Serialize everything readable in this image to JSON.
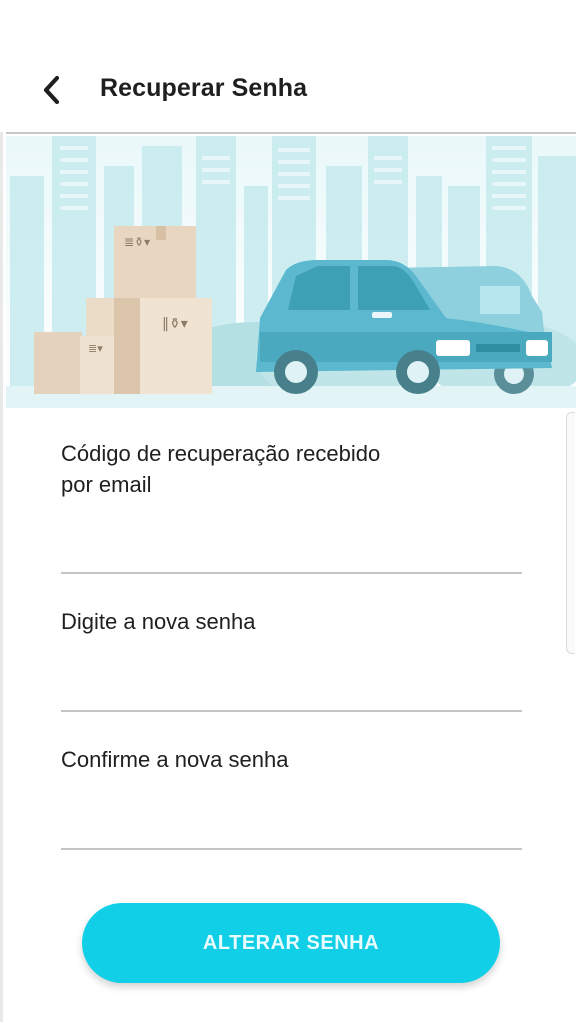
{
  "header": {
    "title": "Recuperar Senha",
    "back_icon": "chevron-left-icon"
  },
  "banner": {
    "description_icon": "delivery-car-boxes-illustration",
    "sky_color": "#e4f6f8",
    "building_color": "#bfe6ea",
    "car_color": "#5bb8cf",
    "box_color": "#e9d8c3"
  },
  "form": {
    "recovery_code": {
      "label": "Código de recuperação recebido\npor email",
      "value": "",
      "placeholder": ""
    },
    "new_password": {
      "label": "Digite a nova senha",
      "value": "",
      "placeholder": ""
    },
    "confirm_password": {
      "label": "Confirme a nova senha",
      "value": "",
      "placeholder": ""
    }
  },
  "actions": {
    "submit_label": "ALTERAR SENHA",
    "submit_color": "#10cfe6"
  }
}
